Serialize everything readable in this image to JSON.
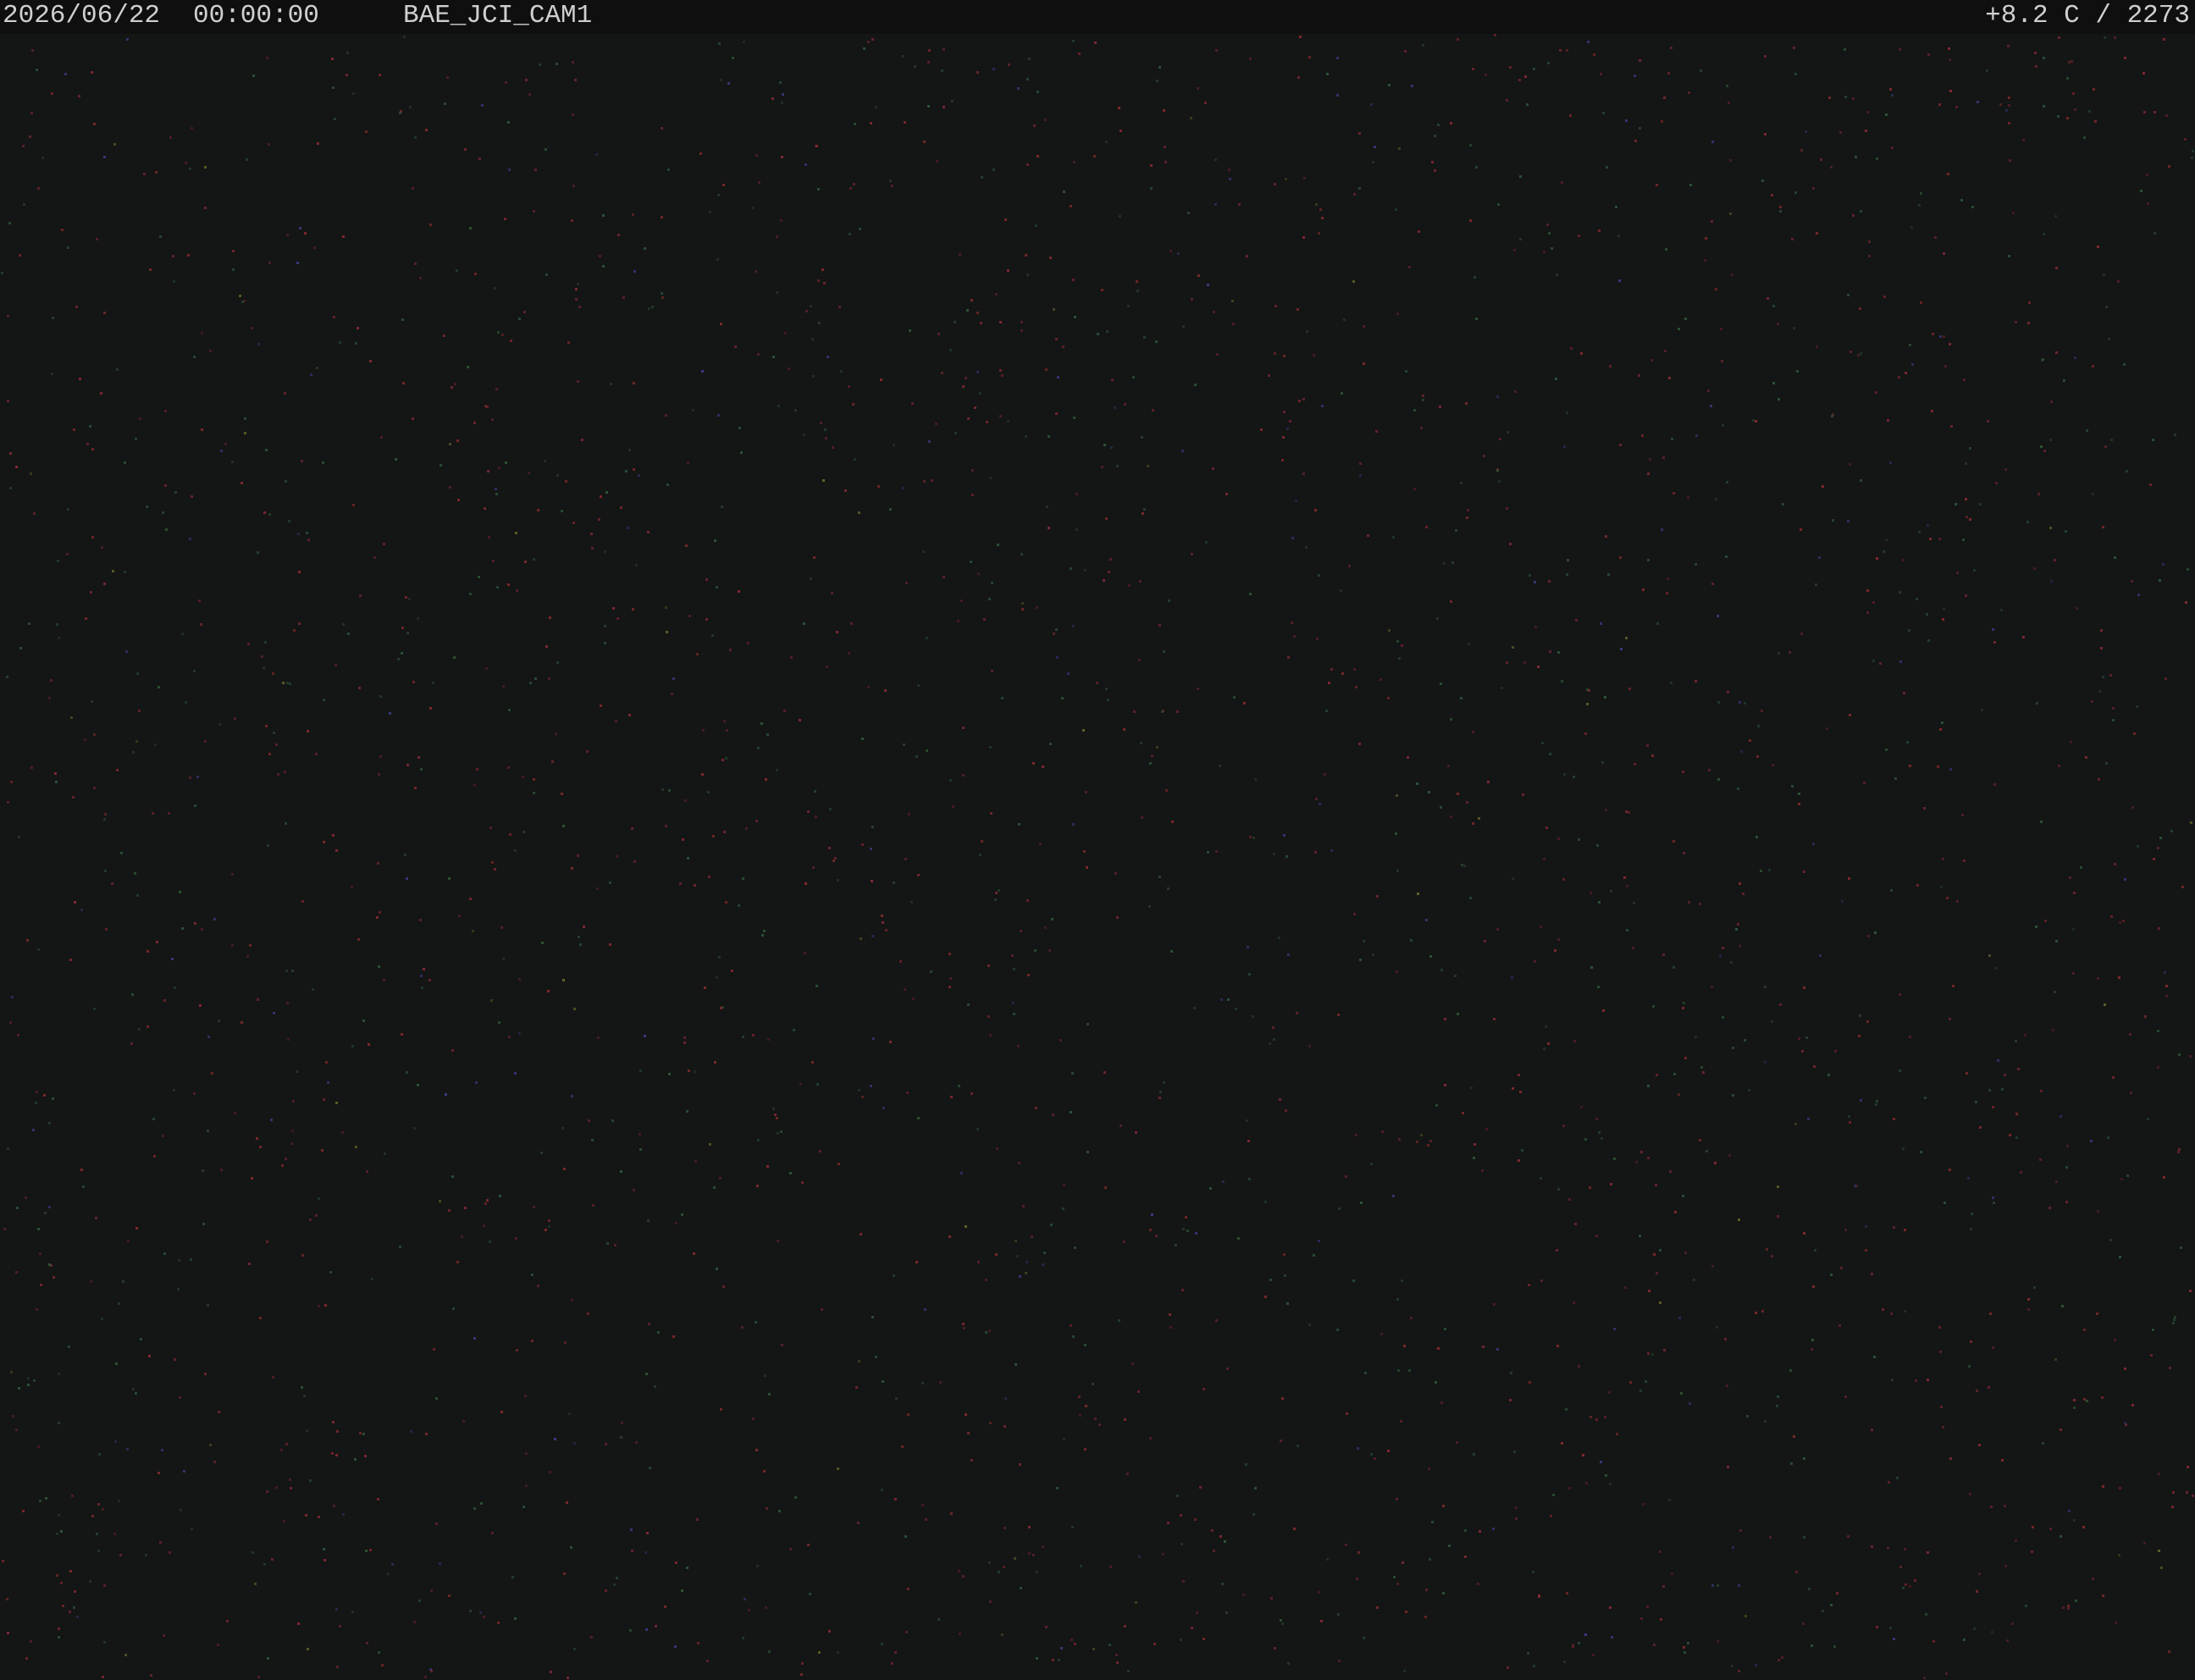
{
  "overlay": {
    "date": "2026/06/22",
    "time": "00:00:00",
    "camera_name": "BAE_JCI_CAM1",
    "temperature_reading": "+8.2 C / 2273"
  },
  "scene": {
    "description_kind": "night sky camera frame with sensor noise",
    "background_color": "#141515",
    "osd_bar_color": "#0f0f0f",
    "osd_text_color": "#cfcfcf",
    "noise_colors": [
      "#8a2a33",
      "#2f5a3a",
      "#3a3f8a",
      "#6a6a2a"
    ]
  }
}
